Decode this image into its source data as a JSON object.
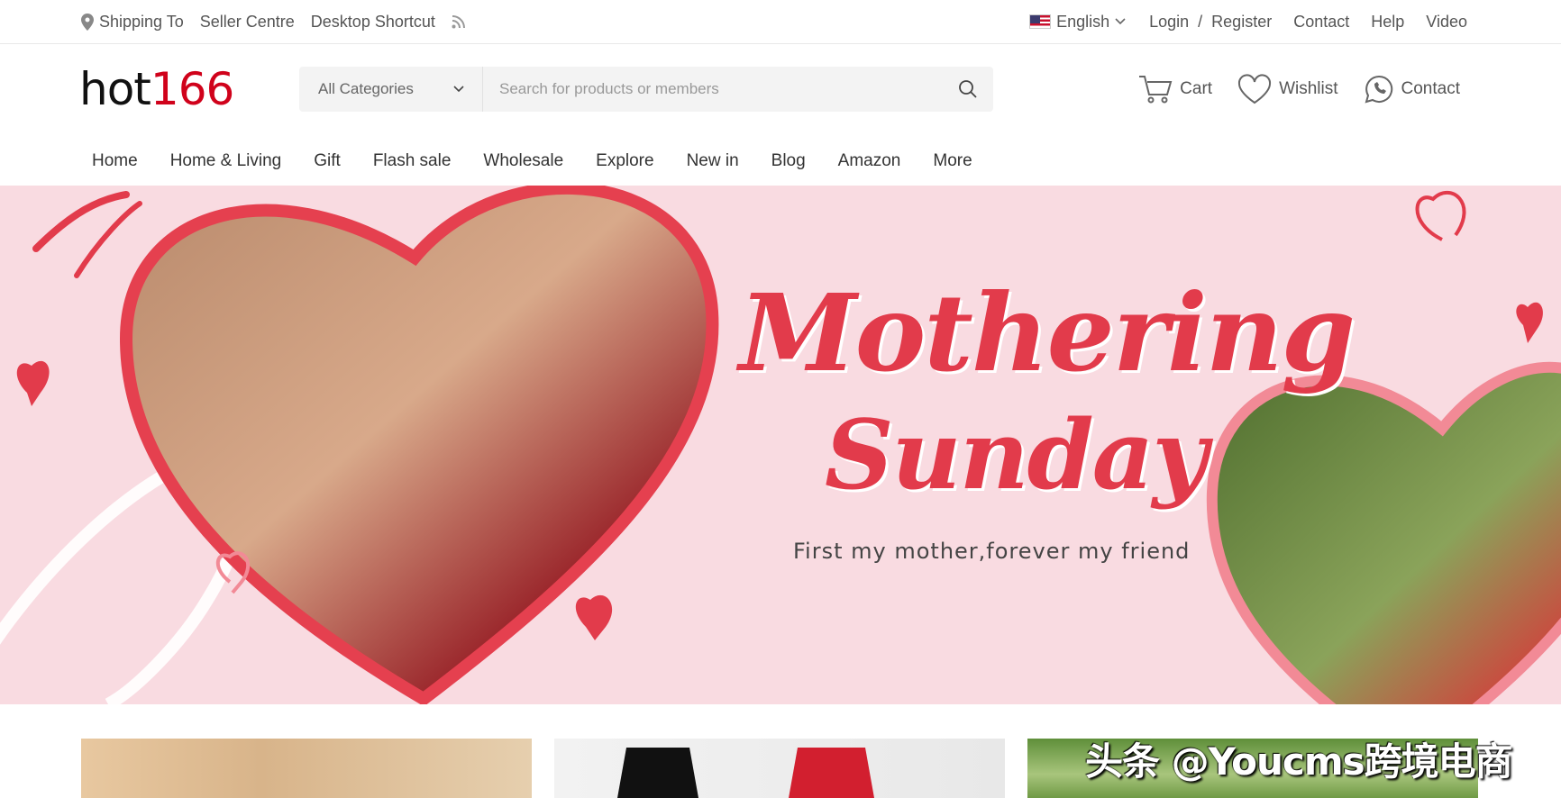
{
  "topbar": {
    "shipping": "Shipping To",
    "seller": "Seller Centre",
    "shortcut": "Desktop Shortcut",
    "language": "English",
    "login": "Login",
    "slash": "/",
    "register": "Register",
    "contact": "Contact",
    "help": "Help",
    "video": "Video"
  },
  "logo": {
    "part1": "hot",
    "part2": "166"
  },
  "search": {
    "category": "All Categories",
    "placeholder": "Search for products or members"
  },
  "header_actions": {
    "cart": "Cart",
    "wishlist": "Wishlist",
    "contact": "Contact"
  },
  "nav": [
    "Home",
    "Home & Living",
    "Gift",
    "Flash sale",
    "Wholesale",
    "Explore",
    "New in",
    "Blog",
    "Amazon",
    "More"
  ],
  "banner": {
    "title_line1": "Mothering",
    "title_line2": "Sunday",
    "subtitle": "First my mother,forever my friend"
  },
  "watermark": "头条 @Youcms跨境电商",
  "colors": {
    "brand_red": "#d0021b",
    "banner_bg": "#f9dbe1",
    "heart_red": "#e23b4b"
  }
}
